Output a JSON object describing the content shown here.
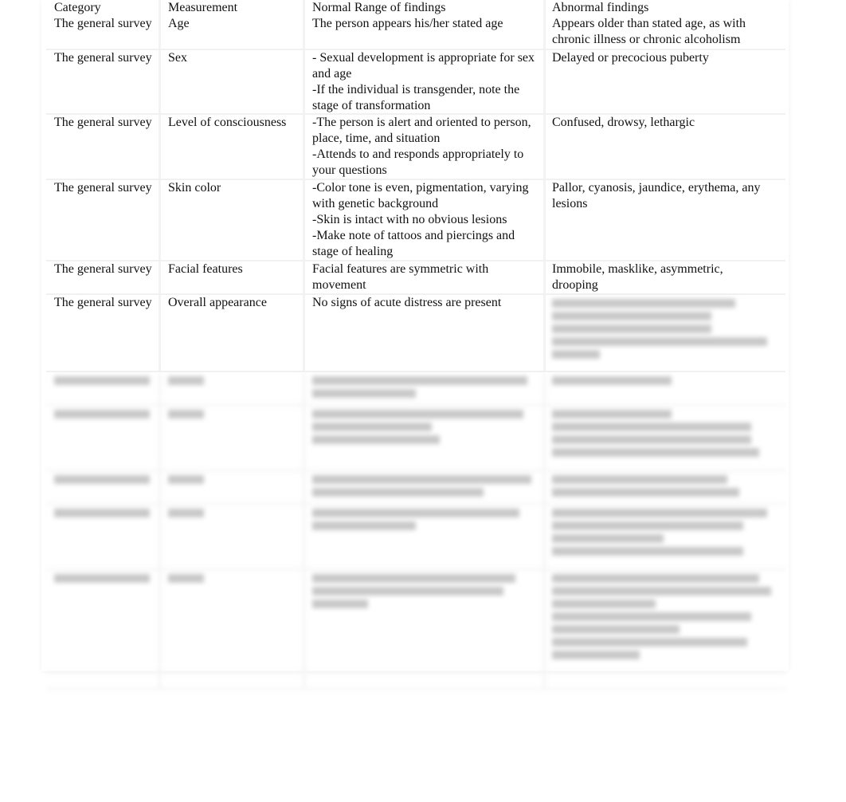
{
  "table": {
    "headers": [
      "Category",
      "Measurement",
      "Normal Range of findings",
      "Abnormal findings"
    ],
    "rows": [
      {
        "category": "The general survey",
        "measurement": "Age",
        "normal": [
          "The person appears his/her stated age"
        ],
        "abnormal": [
          "Appears older than stated age, as with",
          "chronic illness or chronic alcoholism"
        ]
      },
      {
        "category": "The general survey",
        "measurement": "Sex",
        "normal": [
          "- Sexual development is appropriate for sex",
          "and age",
          "-If the individual is transgender, note the",
          "stage of transformation"
        ],
        "abnormal": [
          "Delayed or precocious puberty"
        ]
      },
      {
        "category": "The general survey",
        "measurement": "Level of consciousness",
        "normal": [
          "-The person is alert and oriented to person,",
          "place, time, and situation",
          "-Attends to and responds appropriately to",
          "your questions"
        ],
        "abnormal": [
          "Confused, drowsy, lethargic"
        ]
      },
      {
        "category": "The general survey",
        "measurement": "Skin color",
        "normal": [
          "-Color tone is even, pigmentation, varying",
          "with genetic background",
          "-Skin is intact with no obvious lesions",
          "-Make note of tattoos and piercings and",
          "stage of healing"
        ],
        "abnormal": [
          "Pallor, cyanosis, jaundice, erythema, any",
          "lesions"
        ]
      },
      {
        "category": "The general survey",
        "measurement": "Facial features",
        "normal": [
          "Facial features are symmetric with",
          "movement"
        ],
        "abnormal": [
          "Immobile, masklike, asymmetric,",
          "drooping"
        ]
      },
      {
        "category": "The general survey",
        "measurement": "Overall appearance",
        "normal": [
          "No signs of acute distress are present"
        ],
        "abnormal": []
      }
    ]
  }
}
